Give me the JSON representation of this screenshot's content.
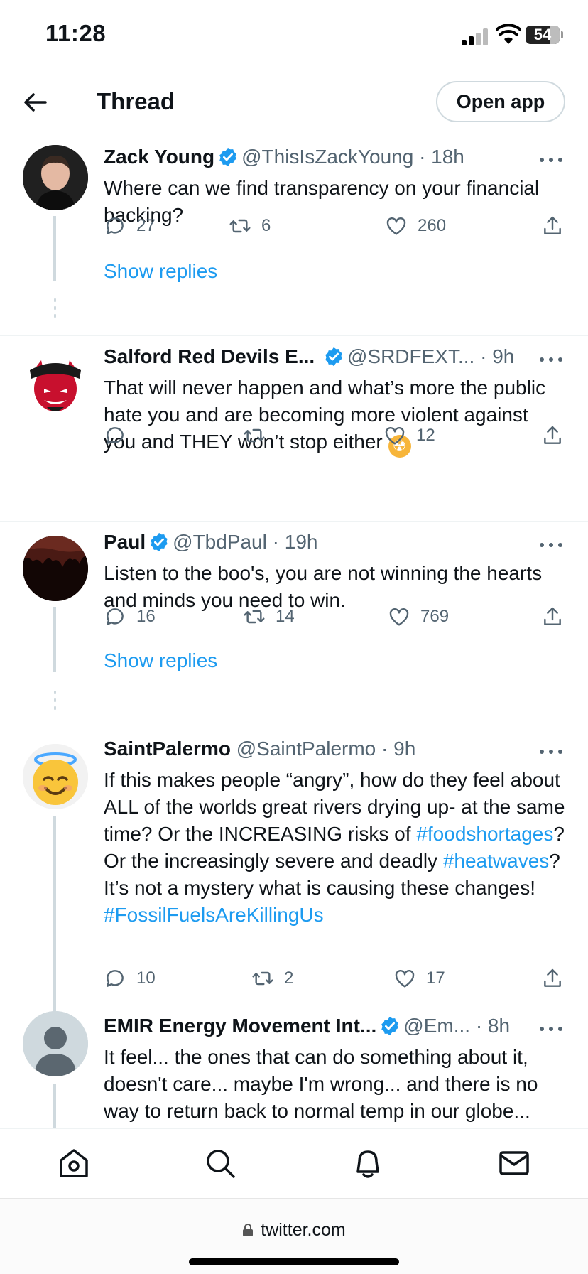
{
  "status": {
    "time": "11:28",
    "battery": "54"
  },
  "header": {
    "title": "Thread",
    "open_app": "Open app"
  },
  "tweets": [
    {
      "name": "Zack Young",
      "handle": "@ThisIsZackYoung",
      "time": "· 18h",
      "text": "Where can we find transparency on your financial backing?",
      "replies": "27",
      "retweets": "6",
      "likes": "260",
      "show_replies": "Show replies"
    },
    {
      "name": "Salford Red Devils E...",
      "handle": "@SRDFEXT...",
      "time": "· 9h",
      "text": "That will never happen and what’s more the public hate you and are becoming more violent against you and THEY won’t stop either",
      "emoji": "☢",
      "replies": "",
      "retweets": "",
      "likes": "12"
    },
    {
      "name": "Paul",
      "handle": "@TbdPaul",
      "time": "· 19h",
      "text": "Listen to the boo's, you are not winning the hearts and minds you need to win.",
      "replies": "16",
      "retweets": "14",
      "likes": "769",
      "show_replies": "Show replies"
    },
    {
      "name": "SaintPalermo",
      "handle": "@SaintPalermo",
      "time": "· 9h",
      "text_parts": [
        "If this makes people “angry”, how do they feel about ALL of the worlds great rivers drying up- at the same time? Or the INCREASING risks of ",
        "#foodshortages",
        "? Or the increasingly severe and deadly ",
        "#heatwaves",
        "? It’s not a mystery what is causing these changes! ",
        "#FossilFuelsAreKillingUs"
      ],
      "replies": "10",
      "retweets": "2",
      "likes": "17"
    },
    {
      "name": "EMIR Energy Movement Int...",
      "handle": "@Em...",
      "time": "· 8h",
      "text": "It feel... the ones that can do something about it, doesn't care... maybe I'm wrong... and there is no way to return back to normal temp in our globe..."
    }
  ],
  "footer": {
    "url": "twitter.com"
  },
  "colors": {
    "accent": "#1d9bf0",
    "muted": "#536471",
    "text": "#0f1419",
    "thread_line": "#cfd9de"
  },
  "icons": [
    "back-arrow-icon",
    "verified-badge-icon",
    "reply-icon",
    "retweet-icon",
    "like-icon",
    "share-icon",
    "more-icon",
    "home-icon",
    "search-icon",
    "notifications-icon",
    "messages-icon",
    "lock-icon"
  ]
}
